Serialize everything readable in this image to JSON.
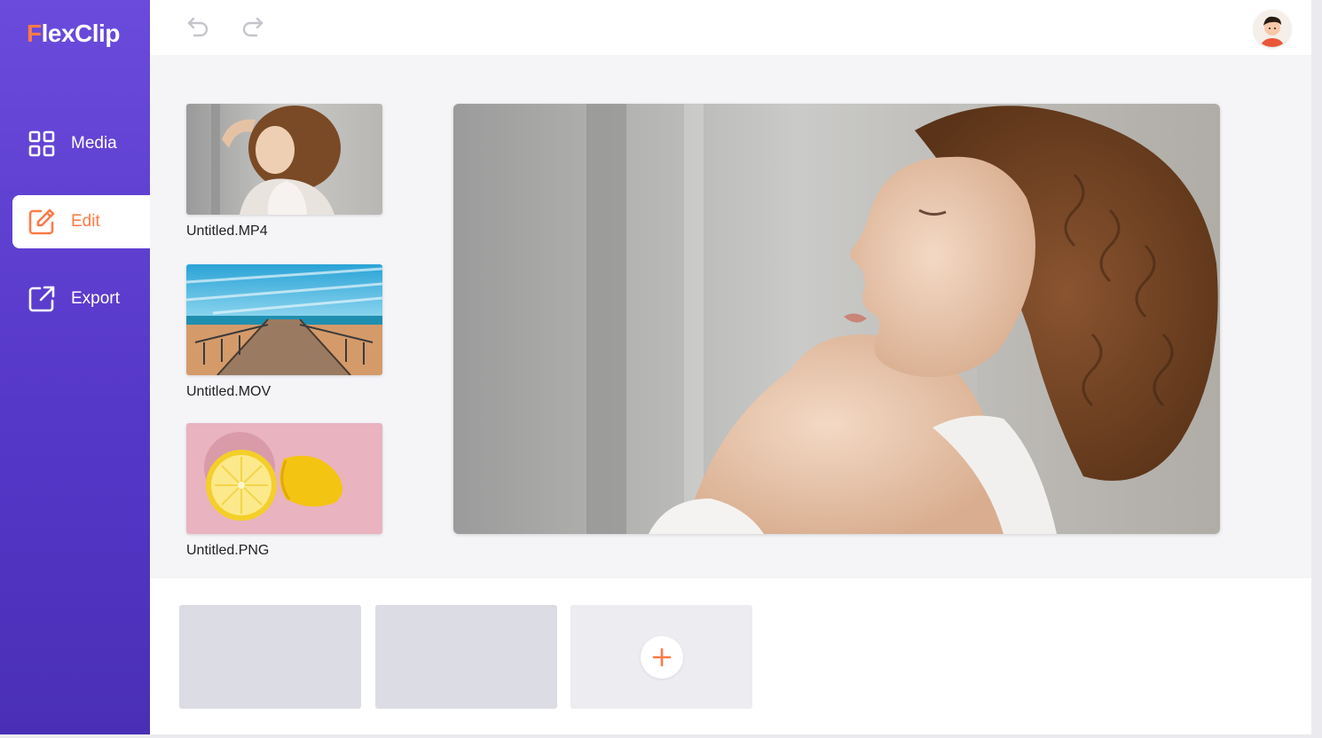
{
  "app": {
    "logo_first": "F",
    "logo_rest": "lexClip",
    "brand_colors": {
      "sidebar": "#5a3dd0",
      "accent": "#ff7a45"
    }
  },
  "sidebar": {
    "items": [
      {
        "label": "Media",
        "icon": "grid-icon",
        "active": false
      },
      {
        "label": "Edit",
        "icon": "edit-icon",
        "active": true
      },
      {
        "label": "Export",
        "icon": "export-icon",
        "active": false
      }
    ]
  },
  "toolbar": {
    "undo_icon": "undo-icon",
    "redo_icon": "redo-icon",
    "avatar_icon": "user-avatar"
  },
  "media": {
    "files": [
      {
        "name": "Untitled.MP4",
        "thumb": "woman-curly-hair"
      },
      {
        "name": "Untitled.MOV",
        "thumb": "beach-boardwalk"
      },
      {
        "name": "Untitled.PNG",
        "thumb": "lemon-halves"
      }
    ]
  },
  "preview": {
    "content": "woman-curly-hair-closeup"
  },
  "timeline": {
    "slots": [
      "empty",
      "empty",
      "add"
    ],
    "add_icon": "plus-icon"
  }
}
